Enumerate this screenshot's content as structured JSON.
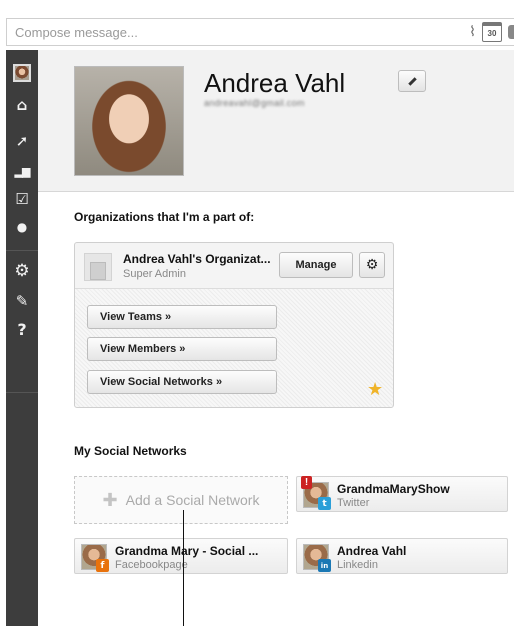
{
  "compose": {
    "placeholder": "Compose message...",
    "tools": [
      {
        "icon": "paperclip-icon",
        "glyph": "📎"
      },
      {
        "icon": "calendar-icon",
        "glyph": "30"
      }
    ]
  },
  "sidebar": {
    "items": [
      {
        "name": "home",
        "icon": "home-icon",
        "glyph": "⌂"
      },
      {
        "name": "send",
        "icon": "paper-plane-icon",
        "glyph": "➚"
      },
      {
        "name": "analytics",
        "icon": "bar-chart-icon",
        "glyph": "▂▆"
      },
      {
        "name": "assignments",
        "icon": "checkbox-icon",
        "glyph": "☑"
      },
      {
        "name": "contacts",
        "icon": "person-icon",
        "glyph": "●"
      },
      {
        "name": "settings",
        "icon": "gear-icon",
        "glyph": "⚙"
      },
      {
        "name": "tools",
        "icon": "wrench-icon",
        "glyph": "✎"
      },
      {
        "name": "help",
        "icon": "question-icon",
        "glyph": "?"
      }
    ]
  },
  "profile": {
    "name": "Andrea Vahl",
    "email": "andreavahl@gmail.com",
    "edit_glyph": "✎"
  },
  "organizations": {
    "title": "Organizations that I'm a part of:",
    "org": {
      "name": "Andrea Vahl's Organizat...",
      "role": "Super Admin",
      "manage_label": "Manage",
      "gear_glyph": "⚙",
      "links": [
        "View Teams »",
        "View Members »",
        "View Social Networks »"
      ],
      "star_glyph": "★"
    }
  },
  "social": {
    "title": "My Social Networks",
    "add_label": "Add a Social Network",
    "add_glyph": "✚",
    "networks": [
      {
        "name": "GrandmaMaryShow",
        "type": "Twitter",
        "badge": "t",
        "badge_color": "#2b9fd8",
        "alert": "!"
      },
      {
        "name": "Grandma Mary - Social ...",
        "type": "Facebookpage",
        "badge": "f",
        "badge_color": "#e8720c",
        "alert": ""
      },
      {
        "name": "Andrea Vahl",
        "type": "Linkedin",
        "badge": "in",
        "badge_color": "#1b78b4",
        "alert": ""
      }
    ]
  },
  "colors": {
    "sidebar_bg": "#3d3d3d",
    "star": "#f0b429",
    "alert": "#cc2222"
  }
}
